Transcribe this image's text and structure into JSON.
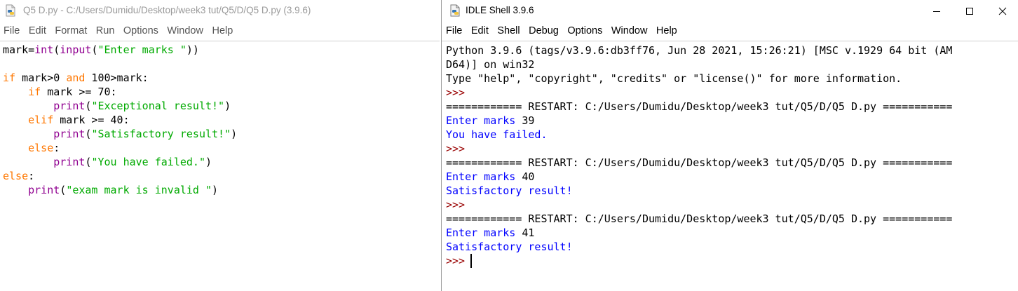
{
  "editor": {
    "title": "Q5 D.py - C:/Users/Dumidu/Desktop/week3 tut/Q5/D/Q5 D.py (3.9.6)",
    "menu": [
      "File",
      "Edit",
      "Format",
      "Run",
      "Options",
      "Window",
      "Help"
    ],
    "code": [
      [
        [
          "df",
          "mark="
        ],
        [
          "bi",
          "int"
        ],
        [
          "df",
          "("
        ],
        [
          "bi",
          "input"
        ],
        [
          "df",
          "("
        ],
        [
          "st",
          "\"Enter marks \""
        ],
        [
          "df",
          "))"
        ]
      ],
      [],
      [
        [
          "kw",
          "if"
        ],
        [
          "df",
          " mark>0 "
        ],
        [
          "kw",
          "and"
        ],
        [
          "df",
          " 100>mark:"
        ]
      ],
      [
        [
          "df",
          "    "
        ],
        [
          "kw",
          "if"
        ],
        [
          "df",
          " mark >= 70:"
        ]
      ],
      [
        [
          "df",
          "        "
        ],
        [
          "bi",
          "print"
        ],
        [
          "df",
          "("
        ],
        [
          "st",
          "\"Exceptional result!\""
        ],
        [
          "df",
          ")"
        ]
      ],
      [
        [
          "df",
          "    "
        ],
        [
          "kw",
          "elif"
        ],
        [
          "df",
          " mark >= 40:"
        ]
      ],
      [
        [
          "df",
          "        "
        ],
        [
          "bi",
          "print"
        ],
        [
          "df",
          "("
        ],
        [
          "st",
          "\"Satisfactory result!\""
        ],
        [
          "df",
          ")"
        ]
      ],
      [
        [
          "df",
          "    "
        ],
        [
          "kw",
          "else"
        ],
        [
          "df",
          ":"
        ]
      ],
      [
        [
          "df",
          "        "
        ],
        [
          "bi",
          "print"
        ],
        [
          "df",
          "("
        ],
        [
          "st",
          "\"You have failed.\""
        ],
        [
          "df",
          ")"
        ]
      ],
      [
        [
          "kw",
          "else"
        ],
        [
          "df",
          ":"
        ]
      ],
      [
        [
          "df",
          "    "
        ],
        [
          "bi",
          "print"
        ],
        [
          "df",
          "("
        ],
        [
          "st",
          "\"exam mark is invalid \""
        ],
        [
          "df",
          ")"
        ]
      ]
    ]
  },
  "shell": {
    "title": "IDLE Shell 3.9.6",
    "menu": [
      "File",
      "Edit",
      "Shell",
      "Debug",
      "Options",
      "Window",
      "Help"
    ],
    "lines": [
      [
        [
          "df",
          "Python 3.9.6 (tags/v3.9.6:db3ff76, Jun 28 2021, 15:26:21) [MSC v.1929 64 bit (AM"
        ]
      ],
      [
        [
          "df",
          "D64)] on win32"
        ]
      ],
      [
        [
          "df",
          "Type \"help\", \"copyright\", \"credits\" or \"license()\" for more information."
        ]
      ],
      [
        [
          "prompt",
          ">>> "
        ]
      ],
      [
        [
          "df",
          "============ RESTART: C:/Users/Dumidu/Desktop/week3 tut/Q5/D/Q5 D.py ==========="
        ]
      ],
      [
        [
          "out",
          "Enter marks "
        ],
        [
          "df",
          "39"
        ]
      ],
      [
        [
          "out",
          "You have failed."
        ]
      ],
      [
        [
          "prompt",
          ">>> "
        ]
      ],
      [
        [
          "df",
          "============ RESTART: C:/Users/Dumidu/Desktop/week3 tut/Q5/D/Q5 D.py ==========="
        ]
      ],
      [
        [
          "out",
          "Enter marks "
        ],
        [
          "df",
          "40"
        ]
      ],
      [
        [
          "out",
          "Satisfactory result!"
        ]
      ],
      [
        [
          "prompt",
          ">>> "
        ]
      ],
      [
        [
          "df",
          "============ RESTART: C:/Users/Dumidu/Desktop/week3 tut/Q5/D/Q5 D.py ==========="
        ]
      ],
      [
        [
          "out",
          "Enter marks "
        ],
        [
          "df",
          "41"
        ]
      ],
      [
        [
          "out",
          "Satisfactory result!"
        ]
      ],
      [
        [
          "prompt",
          ">>>"
        ]
      ]
    ]
  },
  "colors": {
    "keyword": "#ff7700",
    "builtin": "#900090",
    "string": "#00aa00",
    "shell_output": "#0000ff",
    "prompt": "#990000"
  },
  "icons": {
    "editor_title_icon": "python-file-icon",
    "shell_title_icon": "python-file-icon",
    "minimize": "minimize-icon",
    "maximize": "maximize-icon",
    "close": "close-icon"
  }
}
